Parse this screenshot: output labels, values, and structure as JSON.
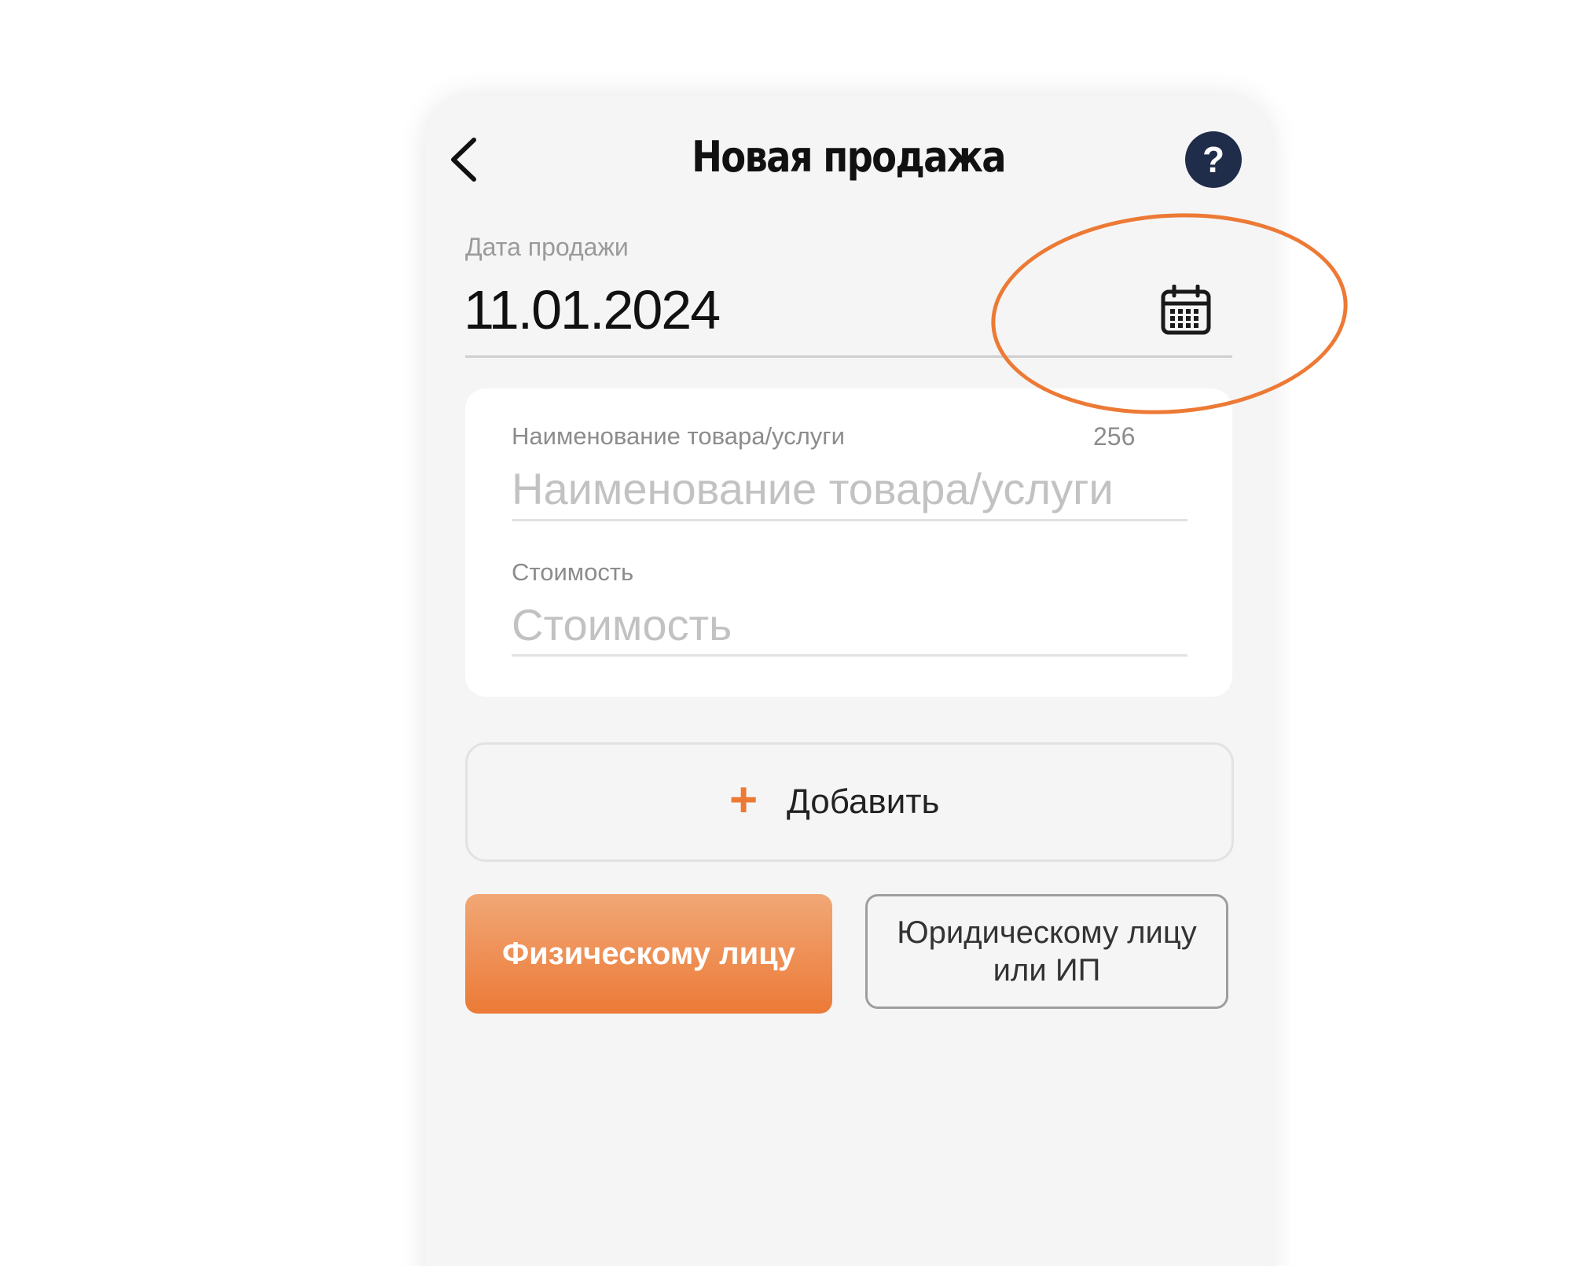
{
  "header": {
    "title": "Новая продажа",
    "help_label": "?"
  },
  "date_field": {
    "label": "Дата продажи",
    "value": "11.01.2024"
  },
  "item_card": {
    "name_label": "Наименование товара/услуги",
    "name_counter": "256",
    "name_placeholder": "Наименование товара/услуги",
    "name_value": "",
    "price_label": "Стоимость",
    "price_placeholder": "Стоимость",
    "price_value": ""
  },
  "add_button": {
    "icon": "+",
    "label": "Добавить"
  },
  "customer_type": {
    "individual_label": "Физическому лицу",
    "legal_label_line1": "Юридическому лицу",
    "legal_label_line2": "или ИП",
    "selected": "individual"
  },
  "colors": {
    "accent": "#ec7a35",
    "help_button": "#1f2d4a",
    "background": "#f5f5f5",
    "card": "#ffffff"
  },
  "icons": {
    "back": "chevron-left-icon",
    "help": "question-icon",
    "calendar": "calendar-icon",
    "add": "plus-icon"
  }
}
